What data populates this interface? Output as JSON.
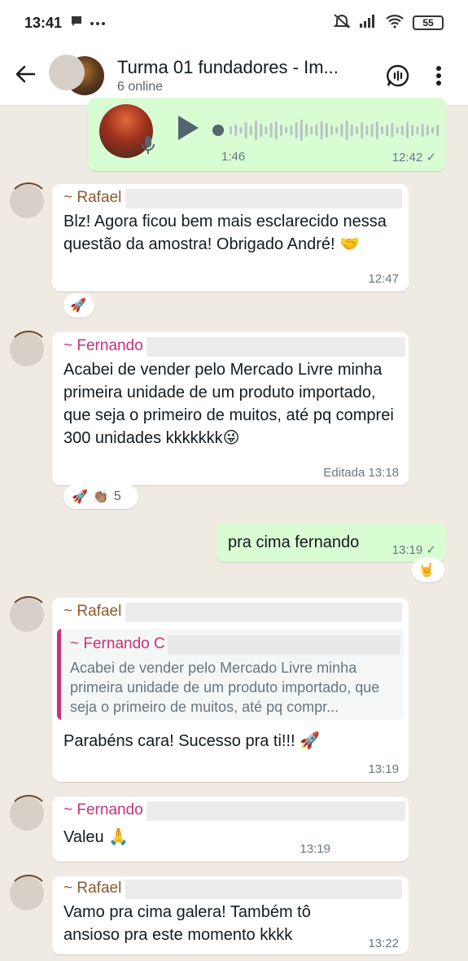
{
  "status_bar": {
    "time": "13:41",
    "left_icons": [
      "chat-bubble-icon",
      "more-dots-icon"
    ],
    "right_icons": [
      "muted-bell-icon",
      "signal-icon",
      "wifi-icon"
    ],
    "battery": "55"
  },
  "header": {
    "title": "Turma 01 fundadores  - Im...",
    "subtitle": "6 online"
  },
  "messages": [
    {
      "type": "voice",
      "direction": "out",
      "duration": "1:46",
      "time": "12:42"
    },
    {
      "sender": "~ Rafael",
      "text": "Blz! Agora ficou bem mais esclarecido nessa questão da amostra! Obrigado André! 🤝",
      "time": "12:47",
      "reactions": [
        "🚀"
      ]
    },
    {
      "sender": "~ Fernando",
      "text": "Acabei de vender pelo Mercado Livre minha primeira unidade de um produto importado, que seja o primeiro de muitos, até pq comprei 300 unidades kkkkkkk😜",
      "time": "Editada 13:18",
      "reactions": [
        "🚀",
        "👏🏽"
      ],
      "reaction_count": "5"
    },
    {
      "direction": "out",
      "text": "pra cima fernando",
      "time": "13:19",
      "reactions": [
        "🤘"
      ]
    },
    {
      "sender": "~ Rafael",
      "quote_sender": "~ Fernando C",
      "quote_text": "Acabei de vender pelo Mercado Livre minha primeira unidade de um produto importado, que seja o primeiro de muitos, até pq compr...",
      "text": "Parabéns cara! Sucesso pra ti!!! 🚀",
      "time": "13:19"
    },
    {
      "sender": "~ Fernando",
      "text": "Valeu 🙏",
      "time": "13:19"
    },
    {
      "sender": "~ Rafael",
      "text": "Vamo pra cima galera! Também tô ansioso pra este momento kkkk",
      "time": "13:22"
    }
  ],
  "colors": {
    "chat_background": "#efeae2",
    "outgoing_bubble": "#d9fdd3",
    "incoming_bubble": "#ffffff",
    "sender_rafael": "#8a5a2b",
    "sender_fernando": "#c7317a"
  }
}
